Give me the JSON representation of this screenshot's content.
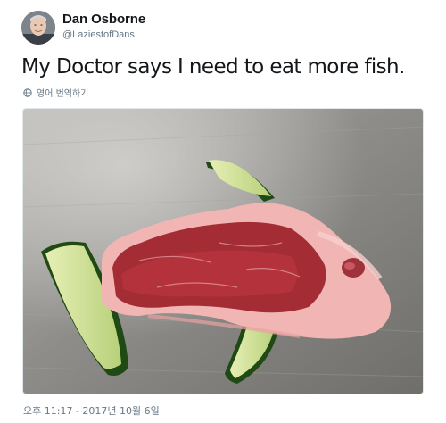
{
  "tweet": {
    "author": {
      "name": "Dan Osborne",
      "handle": "@LaziestofDans"
    },
    "text": "My Doctor says I need to eat more fish.",
    "translate_label": "영어 번역하기",
    "timestamp": "오후 11:17 - 2017년 10월 6일"
  },
  "icons": {
    "translate": "globe-icon"
  },
  "colors": {
    "text_primary": "#14171a",
    "text_secondary": "#657786"
  }
}
